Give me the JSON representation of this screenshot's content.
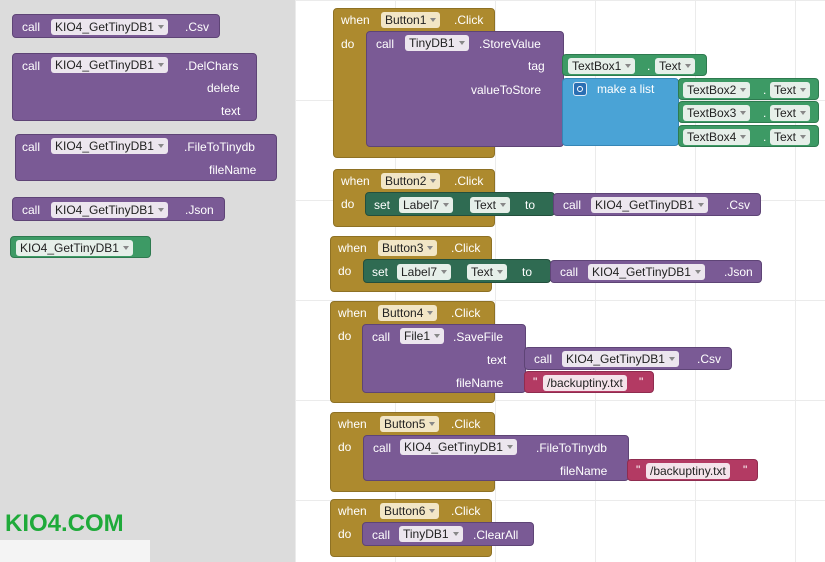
{
  "flyout": {
    "csv_block": {
      "call": "call",
      "component": "KIO4_GetTinyDB1",
      "method": ".Csv"
    },
    "delchars_block": {
      "call": "call",
      "component": "KIO4_GetTinyDB1",
      "method": ".DelChars",
      "arg1": "delete",
      "arg2": "text"
    },
    "filetotinydb_block": {
      "call": "call",
      "component": "KIO4_GetTinyDB1",
      "method": ".FileToTinydb",
      "arg1": "fileName"
    },
    "json_block": {
      "call": "call",
      "component": "KIO4_GetTinyDB1",
      "method": ".Json"
    },
    "component_block": {
      "component": "KIO4_GetTinyDB1"
    },
    "logo": "KIO4.COM"
  },
  "workspace": {
    "button1": {
      "when": "when",
      "button": "Button1",
      "event": ".Click",
      "do": "do",
      "call": "call",
      "component": "TinyDB1",
      "method": ".StoreValue",
      "tag_label": "tag",
      "tag_component": "TextBox1",
      "tag_prop": "Text",
      "value_label": "valueToStore",
      "make_list": "make a list",
      "list_items": [
        {
          "component": "TextBox2",
          "prop": "Text"
        },
        {
          "component": "TextBox3",
          "prop": "Text"
        },
        {
          "component": "TextBox4",
          "prop": "Text"
        }
      ],
      "dot": "."
    },
    "button2": {
      "when": "when",
      "button": "Button2",
      "event": ".Click",
      "do": "do",
      "set": "set",
      "label": "Label7",
      "prop": "Text",
      "to": "to",
      "call": "call",
      "component": "KIO4_GetTinyDB1",
      "method": ".Csv"
    },
    "button3": {
      "when": "when",
      "button": "Button3",
      "event": ".Click",
      "do": "do",
      "set": "set",
      "label": "Label7",
      "prop": "Text",
      "to": "to",
      "call": "call",
      "component": "KIO4_GetTinyDB1",
      "method": ".Json"
    },
    "button4": {
      "when": "when",
      "button": "Button4",
      "event": ".Click",
      "do": "do",
      "call": "call",
      "component": "File1",
      "method": ".SaveFile",
      "text_label": "text",
      "inner_call": "call",
      "inner_component": "KIO4_GetTinyDB1",
      "inner_method": ".Csv",
      "file_label": "fileName",
      "file_value": "/backuptiny.txt",
      "quote": "\""
    },
    "button5": {
      "when": "when",
      "button": "Button5",
      "event": ".Click",
      "do": "do",
      "call": "call",
      "component": "KIO4_GetTinyDB1",
      "method": ".FileToTinydb",
      "file_label": "fileName",
      "file_value": "/backuptiny.txt",
      "quote": "\""
    },
    "button6": {
      "when": "when",
      "button": "Button6",
      "event": ".Click",
      "do": "do",
      "call": "call",
      "component": "TinyDB1",
      "method": ".ClearAll"
    }
  },
  "colors": {
    "procedure": "#7a5a95",
    "event": "#ad8a2e",
    "setter": "#2f6b52",
    "component": "#3d9a65",
    "list": "#4aa3d6",
    "text": "#b33a63",
    "logo": "#1faa3a"
  }
}
